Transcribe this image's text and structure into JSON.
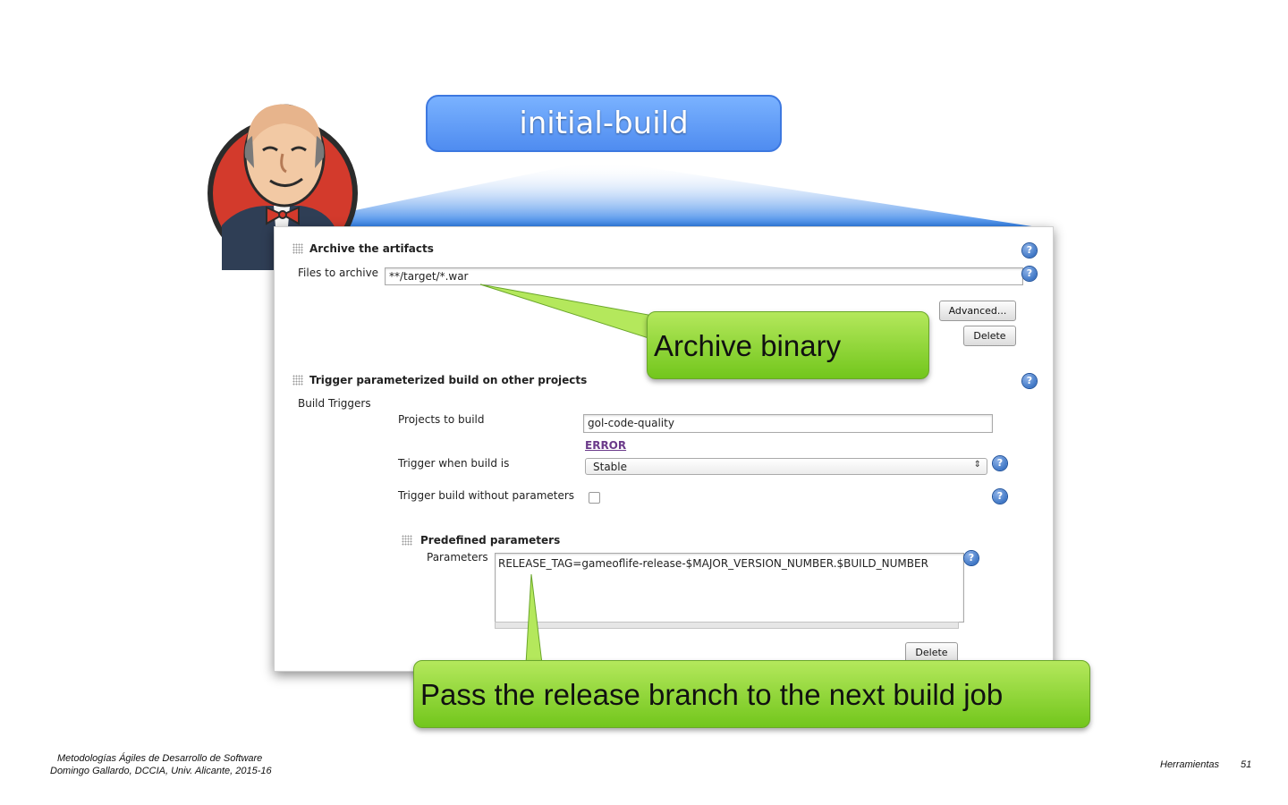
{
  "slide": {
    "title": "initial-build",
    "footer_left_line1": "Metodologías Ágiles de Desarrollo de Software",
    "footer_left_line2": "Domingo Gallardo, DCCIA, Univ. Alicante, 2015-16",
    "footer_section": "Herramientas",
    "footer_page": "51"
  },
  "archive": {
    "heading": "Archive the artifacts",
    "files_label": "Files to archive",
    "files_value": "**/target/*.war",
    "advanced_button": "Advanced...",
    "delete_button": "Delete"
  },
  "trigger": {
    "heading": "Trigger parameterized build on other projects",
    "build_triggers_label": "Build Triggers",
    "projects_label": "Projects to build",
    "projects_value": "gol-code-quality",
    "error_link": "ERROR",
    "when_label": "Trigger when build is",
    "when_value": "Stable",
    "without_params_label": "Trigger build without parameters",
    "without_params_checked": false
  },
  "predefined": {
    "heading": "Predefined parameters",
    "params_label": "Parameters",
    "params_value": "RELEASE_TAG=gameoflife-release-$MAJOR_VERSION_NUMBER.$BUILD_NUMBER",
    "delete_button": "Delete"
  },
  "callouts": {
    "archive": "Archive binary",
    "release": "Pass the release branch to the next build job"
  },
  "icons": {
    "help": "?"
  },
  "colors": {
    "title_pill": "#5b97f5",
    "callout_green": "#8fd63a",
    "beam_blue": "#2f7fe8",
    "jenkins_red": "#d33a2c"
  }
}
